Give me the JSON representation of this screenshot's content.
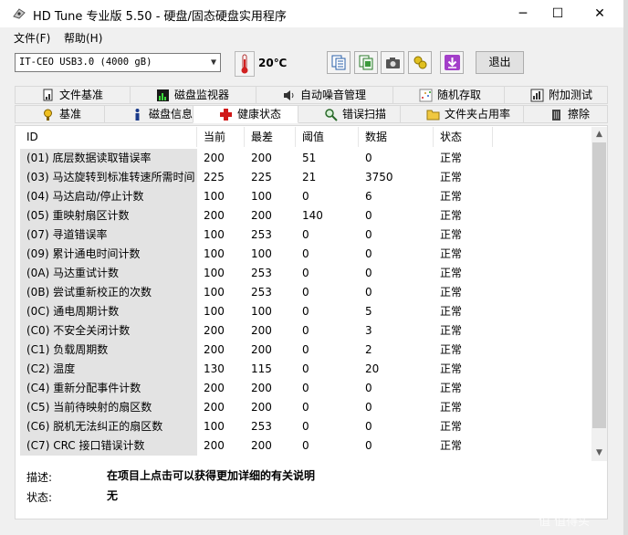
{
  "window": {
    "title": "HD Tune 专业版 5.50 - 硬盘/固态硬盘实用程序",
    "minimize_glyph": "─",
    "maximize_glyph": "☐",
    "close_glyph": "✕"
  },
  "menu": {
    "items": [
      {
        "label": "文件(F)"
      },
      {
        "label": "帮助(H)"
      }
    ]
  },
  "toolbar": {
    "drive": "IT-CEO  USB3.0 (4000 gB)",
    "temperature": "20℃",
    "exit_label": "退出",
    "icons": [
      "copy-text-icon",
      "copy-screenshot-icon",
      "camera-icon",
      "health-options-icon",
      "save-download-icon"
    ]
  },
  "tabs": {
    "row1": [
      {
        "label": "文件基准",
        "icon": "file-benchmark-icon"
      },
      {
        "label": "磁盘监视器",
        "icon": "disk-monitor-icon"
      },
      {
        "label": "自动噪音管理",
        "icon": "speaker-icon"
      },
      {
        "label": "随机存取",
        "icon": "random-access-icon"
      },
      {
        "label": "附加测试",
        "icon": "extra-tests-icon"
      }
    ],
    "row2": [
      {
        "label": "基准",
        "icon": "benchmark-icon"
      },
      {
        "label": "磁盘信息",
        "icon": "info-icon"
      },
      {
        "label": "健康状态",
        "icon": "health-cross-icon"
      },
      {
        "label": "错误扫描",
        "icon": "error-scan-icon"
      },
      {
        "label": "文件夹占用率",
        "icon": "folder-usage-icon"
      },
      {
        "label": "擦除",
        "icon": "erase-icon"
      }
    ]
  },
  "grid": {
    "columns": [
      "ID",
      "当前",
      "最差",
      "阈值",
      "数据",
      "状态"
    ],
    "rows": [
      [
        "(01) 底层数据读取错误率",
        "200",
        "200",
        "51",
        "0",
        "正常"
      ],
      [
        "(03) 马达旋转到标准转速所需时间",
        "225",
        "225",
        "21",
        "3750",
        "正常"
      ],
      [
        "(04) 马达启动/停止计数",
        "100",
        "100",
        "0",
        "6",
        "正常"
      ],
      [
        "(05) 重映射扇区计数",
        "200",
        "200",
        "140",
        "0",
        "正常"
      ],
      [
        "(07) 寻道错误率",
        "100",
        "253",
        "0",
        "0",
        "正常"
      ],
      [
        "(09) 累计通电时间计数",
        "100",
        "100",
        "0",
        "0",
        "正常"
      ],
      [
        "(0A) 马达重试计数",
        "100",
        "253",
        "0",
        "0",
        "正常"
      ],
      [
        "(0B) 尝试重新校正的次数",
        "100",
        "253",
        "0",
        "0",
        "正常"
      ],
      [
        "(0C) 通电周期计数",
        "100",
        "100",
        "0",
        "5",
        "正常"
      ],
      [
        "(C0) 不安全关闭计数",
        "200",
        "200",
        "0",
        "3",
        "正常"
      ],
      [
        "(C1) 负载周期数",
        "200",
        "200",
        "0",
        "2",
        "正常"
      ],
      [
        "(C2) 温度",
        "130",
        "115",
        "0",
        "20",
        "正常"
      ],
      [
        "(C4) 重新分配事件计数",
        "200",
        "200",
        "0",
        "0",
        "正常"
      ],
      [
        "(C5) 当前待映射的扇区数",
        "200",
        "200",
        "0",
        "0",
        "正常"
      ],
      [
        "(C6) 脱机无法纠正的扇区数",
        "100",
        "253",
        "0",
        "0",
        "正常"
      ],
      [
        "(C7) CRC 接口错误计数",
        "200",
        "200",
        "0",
        "0",
        "正常"
      ]
    ]
  },
  "footer": {
    "desc_label": "描述:",
    "desc_text": "在项目上点击可以获得更加详细的有关说明",
    "status_label": "状态:",
    "status_text": "无"
  },
  "watermark": "值 值得买"
}
